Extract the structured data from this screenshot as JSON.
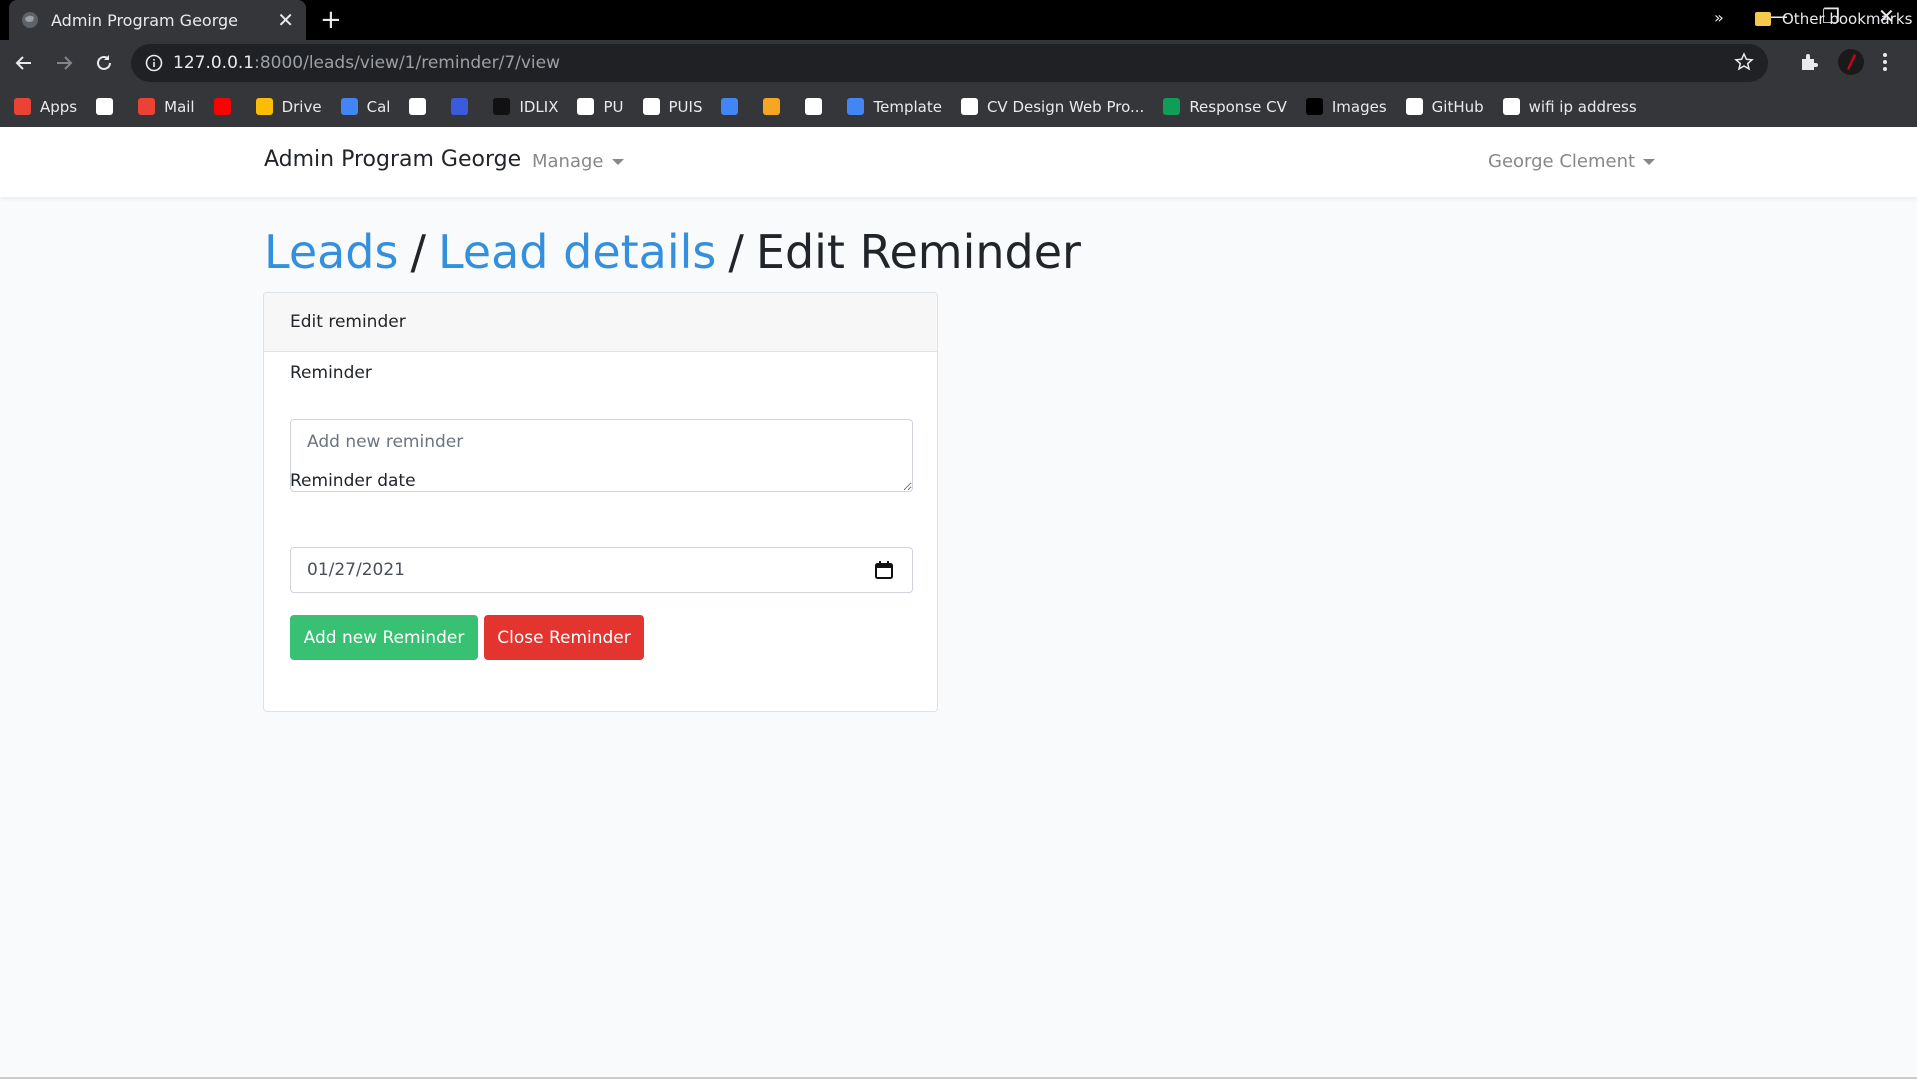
{
  "browser": {
    "tab_title": "Admin Program George",
    "tab_close": "✕",
    "new_tab": "+",
    "url_host": "127.0.0.1",
    "url_path": ":8000/leads/view/1/reminder/7/view",
    "window_controls": [
      "—",
      "❐",
      "✕"
    ],
    "bookmarks": [
      {
        "label": "Apps",
        "icon": "apps-grid-icon",
        "color": "#ea4335"
      },
      {
        "label": "",
        "icon": "google-icon",
        "color": "#ffffff"
      },
      {
        "label": "Mail",
        "icon": "gmail-icon",
        "color": "#ea4335"
      },
      {
        "label": "",
        "icon": "youtube-icon",
        "color": "#ff0000"
      },
      {
        "label": "Drive",
        "icon": "drive-icon",
        "color": "#fbbc04"
      },
      {
        "label": "Cal",
        "icon": "calendar-icon",
        "color": "#4285f4"
      },
      {
        "label": "",
        "icon": "image-bookmark-icon",
        "color": "#ffffff"
      },
      {
        "label": "",
        "icon": "c-bookmark-icon",
        "color": "#3b5bdb"
      },
      {
        "label": "IDLIX",
        "icon": "idlix-icon",
        "color": "#111111"
      },
      {
        "label": "PU",
        "icon": "pu-icon",
        "color": "#ffffff"
      },
      {
        "label": "PUIS",
        "icon": "puis-icon",
        "color": "#ffffff"
      },
      {
        "label": "",
        "icon": "translate-icon",
        "color": "#4285f4"
      },
      {
        "label": "",
        "icon": "nbc-icon",
        "color": "#f5a623"
      },
      {
        "label": "",
        "icon": "document-bookmark-icon",
        "color": "#ffffff"
      },
      {
        "label": "Template",
        "icon": "docs-icon",
        "color": "#4285f4"
      },
      {
        "label": "CV Design Web Pro...",
        "icon": "globe-icon",
        "color": "#ffffff"
      },
      {
        "label": "Response CV",
        "icon": "sheets-icon",
        "color": "#0f9d58"
      },
      {
        "label": "Images",
        "icon": "unsplash-icon",
        "color": "#000000"
      },
      {
        "label": "GitHub",
        "icon": "github-icon",
        "color": "#ffffff"
      },
      {
        "label": "wifi ip address",
        "icon": "globe-icon",
        "color": "#ffffff"
      }
    ],
    "bookmarks_overflow": "»",
    "other_bookmarks": "Other bookmarks"
  },
  "app": {
    "brand": "Admin Program George",
    "manage_menu": "Manage",
    "user_menu": "George Clement"
  },
  "breadcrumb": {
    "leads": "Leads",
    "separator": "/",
    "lead_details": "Lead details",
    "current": "Edit Reminder"
  },
  "form": {
    "card_header": "Edit reminder",
    "reminder_label": "Reminder",
    "reminder_placeholder": "Add new reminder",
    "reminder_value": "",
    "date_label": "Reminder date",
    "date_value": "01/27/2021",
    "submit_label": "Add new Reminder",
    "close_label": "Close Reminder"
  },
  "colors": {
    "link": "#3490dc",
    "success": "#38c172",
    "danger": "#e3342f"
  }
}
